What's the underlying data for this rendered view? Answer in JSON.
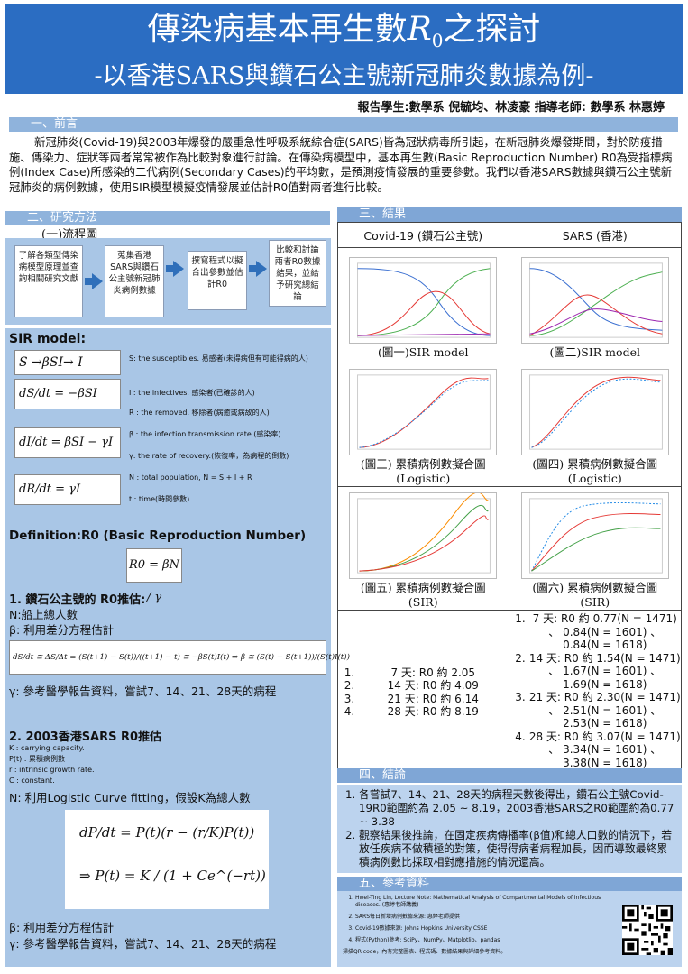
{
  "header": {
    "title_part1": "傳染病基本再生數",
    "title_r": "R",
    "title_sub": "0",
    "title_part2": "之探討",
    "subtitle": "-以香港SARS與鑽石公主號新冠肺炎數據為例-"
  },
  "byline": "報告學生:數學系 倪毓均、林凌豪 指導老師: 數學系 林惠婷",
  "sections": {
    "intro_title": "一、前言",
    "method_title": "二、研究方法",
    "result_title": "三、結果",
    "conclusion_title": "四、結論",
    "ref_title": "五、參考資料"
  },
  "intro_text": "新冠肺炎(Covid-19)與2003年爆發的嚴重急性呼吸系統綜合症(SARS)皆為冠狀病毒所引起，在新冠肺炎爆發期間，對於防疫措施、傳染力、症狀等兩者常常被作為比較對象進行討論。在傳染病模型中，基本再生數(Basic Reproduction Number) R0為受指標病例(Index Case)所感染的二代病例(Secondary Cases)的平均數，是預測疫情發展的重要參數。我們以香港SARS數據與鑽石公主號新冠肺炎的病例數據，使用SIR模型模擬疫情發展並估計R0值對兩者進行比較。",
  "method": {
    "flow_title": "(一)流程圖",
    "flow_steps": [
      "了解各類型傳染病模型原理並查詢相關研究文獻",
      "蒐集香港SARS與鑽石公主號新冠肺炎病例數據",
      "撰寫程式以擬合出參數並估計R0",
      "比較和討論兩者R0數據結果，並給予研究總結論"
    ],
    "sir_title": "SIR model:",
    "sir_scheme": "S →βSI→ I →γI→ R",
    "eq_ds": "dS/dt = −βSI",
    "eq_di": "dI/dt = βSI − γI",
    "eq_dr": "dR/dt = γI",
    "defs": [
      "S: the susceptibles. 易感者(未得病但有可能得病的人)",
      "I : the infectives. 感染者(已確診的人)",
      "R : the removed. 移除者(病癒或病故的人)",
      "β : the infection transmission rate.(感染率)",
      "γ: the rate of recovery.(恢復率，為病程的倒數)",
      "N : total population, N = S + I + R",
      "t : time(時間參數)"
    ],
    "def_title": "Definition:R0 (Basic Reproduction Number)",
    "def_eq": "R0 = βN / γ",
    "part1_title": "1. 鑽石公主號的 R0推估:",
    "part1_n": "N:船上總人數",
    "part1_beta": "β: 利用差分方程估計",
    "part1_eq": "dS/dt ≅ ΔS/Δt = (S(t+1) − S(t))/((t+1) − t) ≅ −βS(t)I(t)  ⇒ β ≅ (S(t) − S(t+1))/(S(t)I(t))",
    "part1_gamma": "γ: 參考醫學報告資料，嘗試7、14、21、28天的病程",
    "part2_title": "2. 2003香港SARS R0推估",
    "part2_defs": [
      "K : carrying capacity.",
      "P(t) : 累積病例數",
      "r : intrinsic growth rate.",
      "C : constant."
    ],
    "part2_n": "N: 利用Logistic Curve fitting，假設K為總人數",
    "logistic_eq1": "dP/dt = P(t)(r − (r/K)P(t))",
    "logistic_eq2": "⇒ P(t) = K / (1 + Ce^(−rt))",
    "part2_beta": "β: 利用差分方程估計",
    "part2_gamma": "γ: 參考醫學報告資料，嘗試7、14、21、28天的病程"
  },
  "results": {
    "col1_head": "Covid-19 (鑽石公主號)",
    "col2_head": "SARS (香港)",
    "figs": [
      {
        "caption_a": "(圖一)SIR model",
        "caption_b": ""
      },
      {
        "caption_a": "(圖二)SIR model",
        "caption_b": ""
      },
      {
        "caption_a": "(圖三) 累積病例數擬合圖",
        "caption_b": "(Logistic)"
      },
      {
        "caption_a": "(圖四) 累積病例數擬合圖",
        "caption_b": "(Logistic)"
      },
      {
        "caption_a": "(圖五) 累積病例數擬合圖",
        "caption_b": "(SIR)"
      },
      {
        "caption_a": "(圖六) 累積病例數擬合圖",
        "caption_b": "(SIR)"
      }
    ],
    "covid_r0": [
      "7 天: R0 約 2.05",
      "14 天: R0 約 4.09",
      "21 天: R0 約 6.14",
      "28 天: R0 約 8.19"
    ],
    "sars_r0": [
      "7 天: R0 約 0.77(N = 1471) 、 0.84(N = 1601) 、 0.84(N = 1618)",
      "14 天: R0 約 1.54(N = 1471) 、 1.67(N = 1601) 、 1.69(N = 1618)",
      "21 天: R0 約 2.30(N = 1471) 、 2.51(N = 1601) 、 2.53(N = 1618)",
      "28 天: R0 約 3.07(N = 1471) 、 3.34(N = 1601) 、 3.38(N = 1618)"
    ]
  },
  "conclusion": [
    "各嘗試7、14、21、28天的病程天數後得出，鑽石公主號Covid-19R0範圍約為 2.05 ~ 8.19，2003香港SARS之R0範圍約為0.77 ~ 3.38",
    "觀察結果後推論，在固定疾病傳播率(β值)和總人口數的情況下，若放任疾病不做積極的對策，使得得病者病程加長，因而導致最終累積病例數比採取相對應措施的情況還高。"
  ],
  "references": [
    "Hwei-Ting Lin, Lecture Note: Mathematical Analysis of Compartmental Models of infectious diseases. (惠婷老師講義)",
    "SARS每日新增病例數據來源: 惠婷老師提供",
    "Covid-19數據來源: Johns Hopkins University CSSE",
    "程式(Python)參考: SciPy、NumPy、Matplotlib、pandas"
  ],
  "qr_note": "掃描QR code，內有完整圖表、程式碼、數據結果與詳細參考資料。",
  "colors": {
    "header_blue": "#2b6dc2",
    "section_bar": "#8fb3dc",
    "panel_blue": "#a9c6e6",
    "arrow_blue": "#2f6fba"
  }
}
